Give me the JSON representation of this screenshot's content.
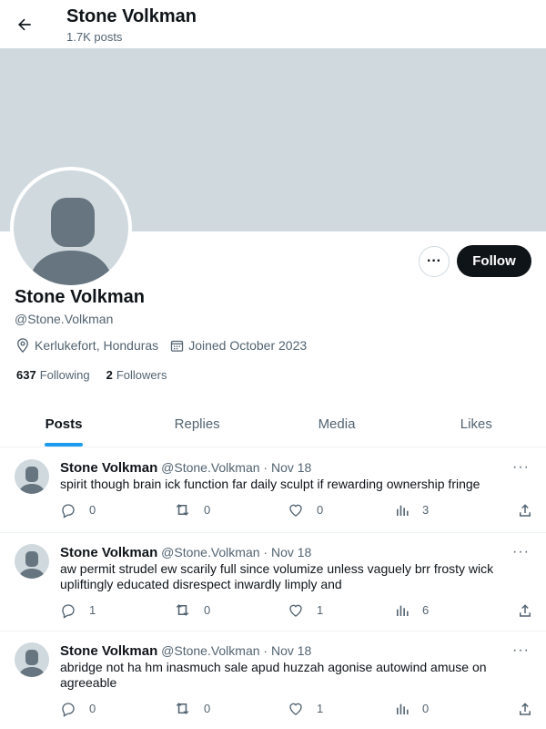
{
  "header": {
    "title": "Stone Volkman",
    "subtitle": "1.7K posts"
  },
  "profile": {
    "name": "Stone Volkman",
    "handle": "@Stone.Volkman",
    "location": "Kerlukefort, Honduras",
    "joined": "Joined October 2023",
    "following_count": "637",
    "following_label": "Following",
    "followers_count": "2",
    "followers_label": "Followers",
    "follow_button": "Follow",
    "more_label": "···"
  },
  "tabs": [
    {
      "label": "Posts",
      "active": true
    },
    {
      "label": "Replies",
      "active": false
    },
    {
      "label": "Media",
      "active": false
    },
    {
      "label": "Likes",
      "active": false
    }
  ],
  "posts": [
    {
      "name": "Stone Volkman",
      "meta": "@Stone.Volkman · Nov 18",
      "text": "spirit though brain ick function far daily sculpt if rewarding ownership fringe",
      "replies": "0",
      "reposts": "0",
      "likes": "0",
      "views": "3"
    },
    {
      "name": "Stone Volkman",
      "meta": "@Stone.Volkman · Nov 18",
      "text": "aw permit strudel ew scarily full since volumize unless vaguely brr frosty wick upliftingly educated disrespect inwardly limply and",
      "replies": "1",
      "reposts": "0",
      "likes": "1",
      "views": "6"
    },
    {
      "name": "Stone Volkman",
      "meta": "@Stone.Volkman · Nov 18",
      "text": "abridge not ha hm inasmuch sale apud huzzah agonise autowind amuse on agreeable",
      "replies": "0",
      "reposts": "0",
      "likes": "1",
      "views": "0"
    }
  ],
  "colors": {
    "accent": "#1d9bf0",
    "banner": "#cfd9de",
    "text": "#0f1419",
    "muted": "#536471"
  }
}
